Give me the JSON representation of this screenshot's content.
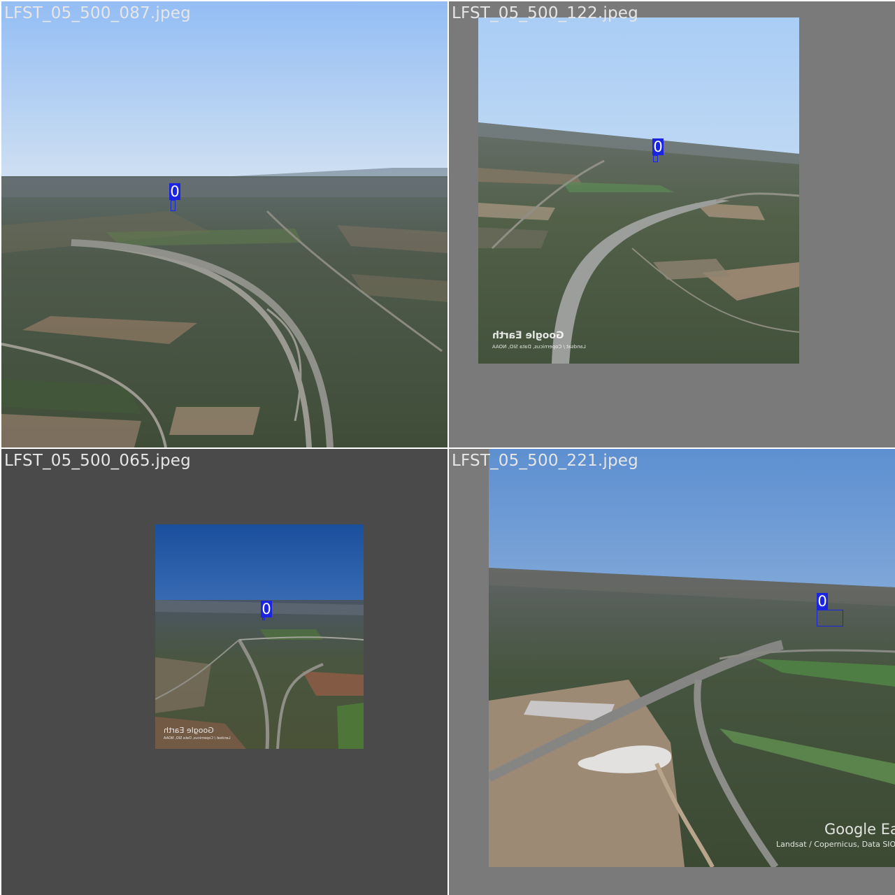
{
  "tiles": [
    {
      "filename": "LFST_05_500_087.jpeg",
      "detection": {
        "class_label": "0"
      }
    },
    {
      "filename": "LFST_05_500_122.jpeg",
      "detection": {
        "class_label": "0"
      },
      "watermark": {
        "brand": "Google Earth",
        "credits": "Landsat / Copernicus, Data SIO, NOAA"
      }
    },
    {
      "filename": "LFST_05_500_065.jpeg",
      "detection": {
        "class_label": "0"
      },
      "watermark": {
        "brand": "Google Earth",
        "credits": "Landsat / Copernicus, Data SIO, NOAA"
      }
    },
    {
      "filename": "LFST_05_500_221.jpeg",
      "detection": {
        "class_label": "0"
      },
      "watermark": {
        "brand": "Google Ear",
        "credits": "Landsat / Copernicus, Data SIO, N"
      }
    }
  ],
  "colors": {
    "detection_box": "#1b24e0",
    "filename_text": "#e6e6e6"
  }
}
